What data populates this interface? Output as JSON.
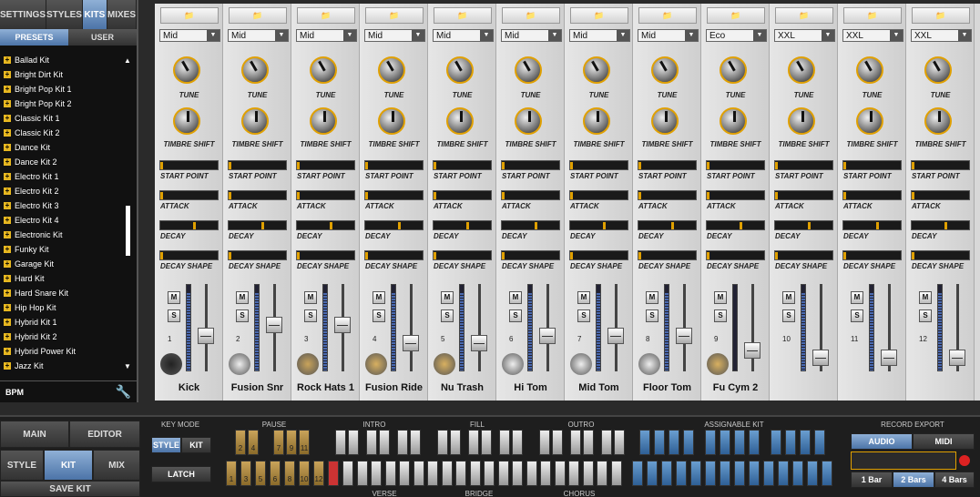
{
  "left": {
    "tabs": [
      "SETTINGS",
      "STYLES",
      "KITS",
      "MIXES"
    ],
    "active_tab": "KITS",
    "subtabs": [
      "PRESETS",
      "USER"
    ],
    "kits": [
      "Ballad Kit",
      "Bright Dirt Kit",
      "Bright Pop Kit 1",
      "Bright Pop Kit 2",
      "Classic Kit 1",
      "Classic Kit 2",
      "Dance Kit",
      "Dance Kit 2",
      "Electro  Kit 1",
      "Electro  Kit 2",
      "Electro  Kit 3",
      "Electro  Kit 4",
      "Electronic Kit",
      "Funky Kit",
      "Garage Kit",
      "Hard Kit",
      "Hard Snare  Kit",
      "Hip Hop Kit",
      "Hybrid  Kit 1",
      "Hybrid  Kit 2",
      "Hybrid Power Kit",
      "Jazz Kit"
    ],
    "bpm_label": "BPM"
  },
  "channels": [
    {
      "num": "1",
      "name": "Kick",
      "mode": "Mid",
      "fader": 0.4,
      "meter": 0.9,
      "icon": "kick-drum-icon"
    },
    {
      "num": "2",
      "name": "Fusion Snr",
      "mode": "Mid",
      "fader": 0.55,
      "meter": 0.9,
      "icon": "snare-drum-icon"
    },
    {
      "num": "3",
      "name": "Rock Hats 1",
      "mode": "Mid",
      "fader": 0.55,
      "meter": 0.9,
      "icon": "hi-hat-icon"
    },
    {
      "num": "4",
      "name": "Fusion Ride",
      "mode": "Mid",
      "fader": 0.3,
      "meter": 0.9,
      "icon": "ride-cymbal-icon"
    },
    {
      "num": "5",
      "name": "Nu Trash",
      "mode": "Mid",
      "fader": 0.3,
      "meter": 0.9,
      "icon": "crash-cymbal-icon"
    },
    {
      "num": "6",
      "name": "Hi Tom",
      "mode": "Mid",
      "fader": 0.4,
      "meter": 0.9,
      "icon": "tom-icon"
    },
    {
      "num": "7",
      "name": "Mid Tom",
      "mode": "Mid",
      "fader": 0.4,
      "meter": 0.9,
      "icon": "tom-icon"
    },
    {
      "num": "8",
      "name": "Floor Tom",
      "mode": "Mid",
      "fader": 0.4,
      "meter": 0.9,
      "icon": "tom-icon"
    },
    {
      "num": "9",
      "name": "Fu Cym 2",
      "mode": "Eco",
      "fader": 0.2,
      "meter": 0.0,
      "icon": "cymbal-icon"
    },
    {
      "num": "10",
      "name": "",
      "mode": "XXL",
      "fader": 0.1,
      "meter": 0.9,
      "icon": ""
    },
    {
      "num": "11",
      "name": "",
      "mode": "XXL",
      "fader": 0.1,
      "meter": 0.9,
      "icon": ""
    },
    {
      "num": "12",
      "name": "",
      "mode": "XXL",
      "fader": 0.1,
      "meter": 0.9,
      "icon": ""
    }
  ],
  "labels": {
    "tune": "TUNE",
    "timbre": "TIMBRE SHIFT",
    "start": "START POINT",
    "attack": "ATTACK",
    "decay": "DECAY",
    "decay_shape": "DECAY SHAPE",
    "mute": "M",
    "solo": "S"
  },
  "bottom": {
    "main": "MAIN",
    "editor": "EDITOR",
    "style": "STYLE",
    "kit": "KIT",
    "mix": "MIX",
    "save_kit": "SAVE KIT",
    "key_mode": "KEY MODE",
    "km_style": "STYLE",
    "km_kit": "KIT",
    "latch": "LATCH",
    "pause": "PAUSE",
    "intro": "INTRO",
    "fill": "FILL",
    "outro": "OUTRO",
    "assignable": "ASSIGNABLE KIT",
    "verse": "VERSE",
    "bridge": "BRIDGE",
    "chorus": "CHORUS",
    "record_export": "RECORD EXPORT",
    "audio": "AUDIO",
    "midi": "MIDI",
    "bar1": "1 Bar",
    "bar2": "2 Bars",
    "bar4": "4 Bars",
    "pause_top": [
      "2",
      "4",
      "7",
      "9",
      "11"
    ],
    "pause_bottom": [
      "1",
      "3",
      "5",
      "6",
      "8",
      "10",
      "12"
    ]
  }
}
